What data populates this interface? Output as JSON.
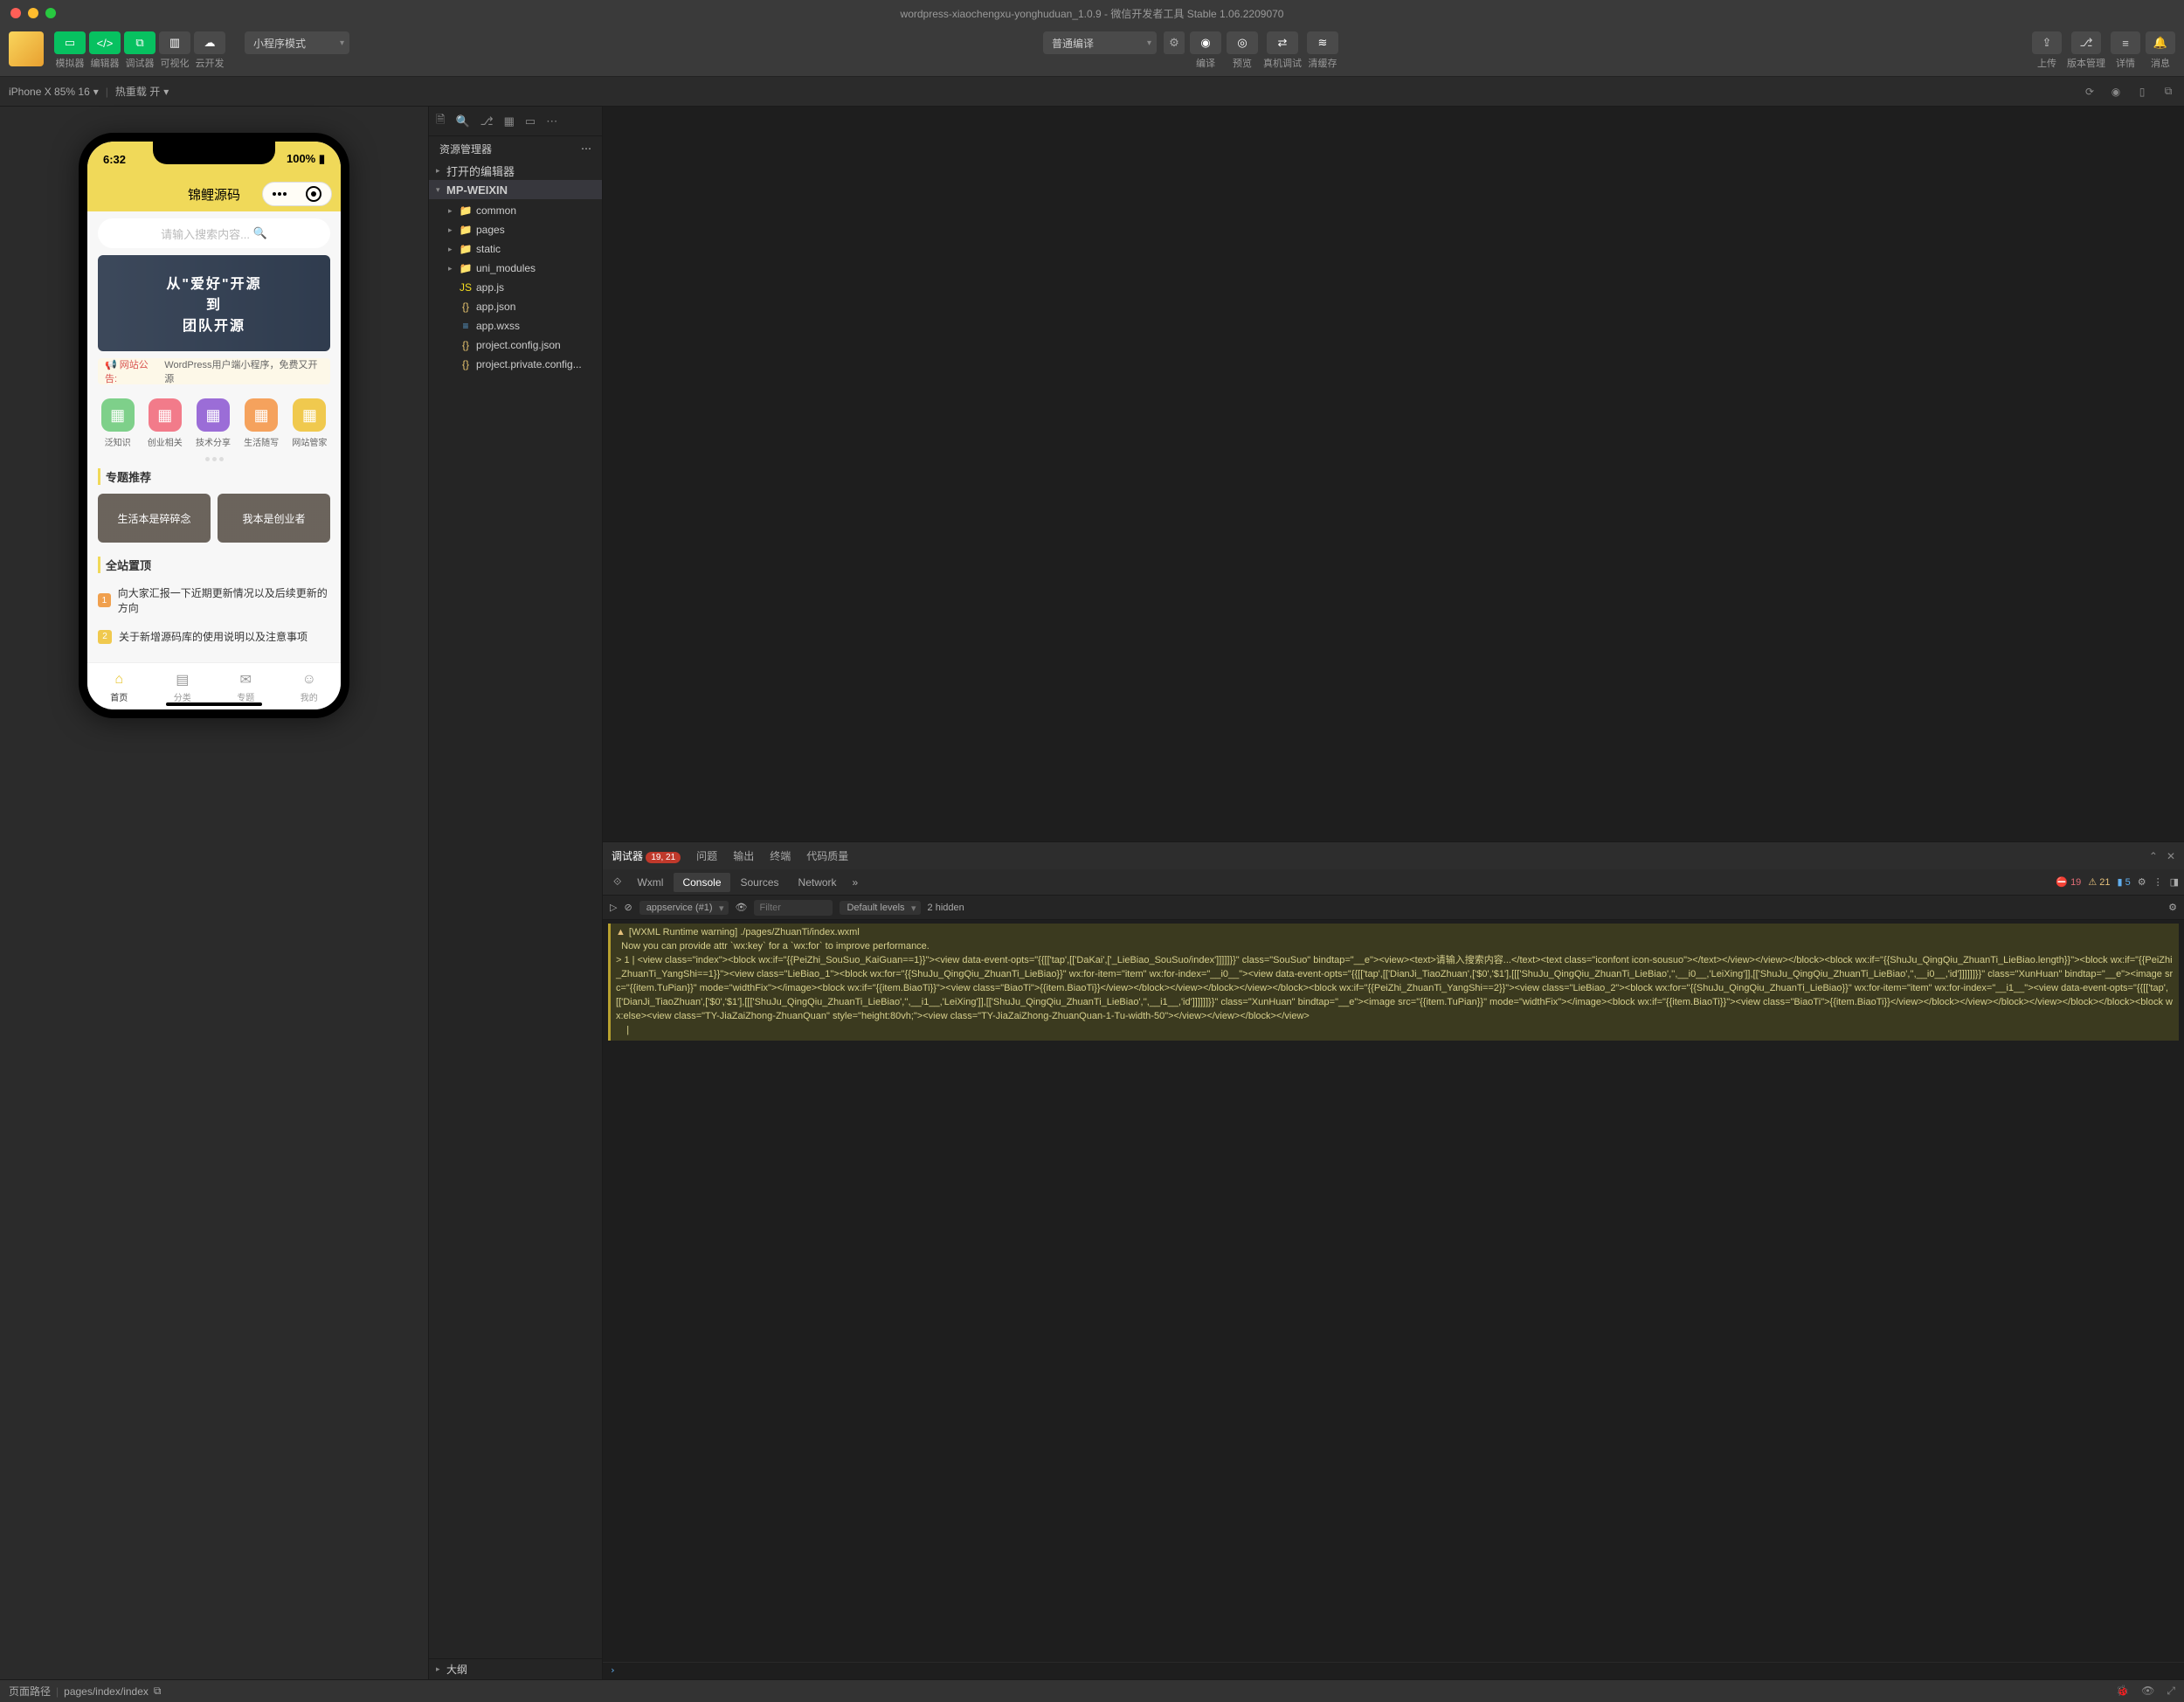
{
  "titlebar": {
    "title": "wordpress-xiaochengxu-yonghuduan_1.0.9 - 微信开发者工具 Stable 1.06.2209070"
  },
  "toolbar": {
    "buttons": {
      "simulator": "模拟器",
      "editor": "编辑器",
      "debugger": "调试器",
      "visualize": "可视化",
      "cloud": "云开发"
    },
    "mode_select": "小程序模式",
    "compile_select": "普通编译",
    "actions": {
      "compile": "编译",
      "preview": "预览",
      "real_debug": "真机调试",
      "clear_cache": "清缓存"
    },
    "right": {
      "upload": "上传",
      "version": "版本管理",
      "details": "详情",
      "notify": "消息"
    }
  },
  "simbar": {
    "device": "iPhone X 85% 16",
    "reload": "热重载 开"
  },
  "phone": {
    "time": "6:32",
    "battery": "100%",
    "app_title": "锦鲤源码",
    "search_placeholder": "请输入搜索内容...",
    "banner": {
      "line1": "从\"爱好\"开源",
      "line2": "到",
      "line3": "团队开源"
    },
    "announce_tag": "📢 网站公告:",
    "announce_text": "WordPress用户端小程序，免费又开源",
    "categories": [
      {
        "label": "泛知识",
        "color": "#7ed08a"
      },
      {
        "label": "创业相关",
        "color": "#f27b8a"
      },
      {
        "label": "技术分享",
        "color": "#9b6dd7"
      },
      {
        "label": "生活随写",
        "color": "#f5a25d"
      },
      {
        "label": "网站管家",
        "color": "#f0c94e"
      }
    ],
    "section_topic": "专题推荐",
    "topics": [
      "生活本是碎碎念",
      "我本是创业者"
    ],
    "section_top": "全站置顶",
    "top_list": [
      {
        "n": "1",
        "color": "#f0a04e",
        "text": "向大家汇报一下近期更新情况以及后续更新的方向"
      },
      {
        "n": "2",
        "color": "#f0c94e",
        "text": "关于新增源码库的使用说明以及注意事项"
      }
    ],
    "tabs": [
      {
        "label": "首页",
        "icon": "⌂"
      },
      {
        "label": "分类",
        "icon": "▤"
      },
      {
        "label": "专题",
        "icon": "✉"
      },
      {
        "label": "我的",
        "icon": "☺"
      }
    ]
  },
  "explorer": {
    "title": "资源管理器",
    "sections": {
      "open_editors": "打开的编辑器",
      "project": "MP-WEIXIN"
    },
    "tree": [
      {
        "type": "folder",
        "label": "common",
        "indent": 1
      },
      {
        "type": "folder",
        "label": "pages",
        "indent": 1
      },
      {
        "type": "folder",
        "label": "static",
        "indent": 1
      },
      {
        "type": "folder",
        "label": "uni_modules",
        "indent": 1
      },
      {
        "type": "file-js",
        "label": "app.js",
        "indent": 1
      },
      {
        "type": "file-json",
        "label": "app.json",
        "indent": 1
      },
      {
        "type": "file-wxss",
        "label": "app.wxss",
        "indent": 1
      },
      {
        "type": "file-json",
        "label": "project.config.json",
        "indent": 1
      },
      {
        "type": "file-json",
        "label": "project.private.config...",
        "indent": 1
      }
    ],
    "outline": "大纲"
  },
  "debugger": {
    "tabs": {
      "debugger": "调试器",
      "problems": "问题",
      "output": "输出",
      "terminal": "终端",
      "quality": "代码质量"
    },
    "badge": "19, 21",
    "devtools": {
      "wxml": "Wxml",
      "console": "Console",
      "sources": "Sources",
      "network": "Network"
    },
    "counts": {
      "errors": "19",
      "warnings": "21",
      "info": "5"
    },
    "context": "appservice (#1)",
    "filter_placeholder": "Filter",
    "levels": "Default levels",
    "hidden": "2 hidden",
    "warning": "[WXML Runtime warning] ./pages/ZhuanTi/index.wxml\n  Now you can provide attr `wx:key` for a `wx:for` to improve performance.\n> 1 | <view class=\"index\"><block wx:if=\"{{PeiZhi_SouSuo_KaiGuan==1}}\"><view data-event-opts=\"{{[['tap',[['DaKai',['_LieBiao_SouSuo/index']]]]]}}\" class=\"SouSuo\" bindtap=\"__e\"><view><text>请输入搜索内容...</text><text class=\"iconfont icon-sousuo\"></text></view></view></block><block wx:if=\"{{ShuJu_QingQiu_ZhuanTi_LieBiao.length}}\"><block wx:if=\"{{PeiZhi_ZhuanTi_YangShi==1}}\"><view class=\"LieBiao_1\"><block wx:for=\"{{ShuJu_QingQiu_ZhuanTi_LieBiao}}\" wx:for-item=\"item\" wx:for-index=\"__i0__\"><view data-event-opts=\"{{[['tap',[['DianJi_TiaoZhuan',['$0','$1'],[[['ShuJu_QingQiu_ZhuanTi_LieBiao','',__i0__,'LeiXing']],[['ShuJu_QingQiu_ZhuanTi_LieBiao','',__i0__,'id']]]]]]}}\" class=\"XunHuan\" bindtap=\"__e\"><image src=\"{{item.TuPian}}\" mode=\"widthFix\"></image><block wx:if=\"{{item.BiaoTi}}\"><view class=\"BiaoTi\">{{item.BiaoTi}}</view></block></view></block></view></block><block wx:if=\"{{PeiZhi_ZhuanTi_YangShi==2}}\"><view class=\"LieBiao_2\"><block wx:for=\"{{ShuJu_QingQiu_ZhuanTi_LieBiao}}\" wx:for-item=\"item\" wx:for-index=\"__i1__\"><view data-event-opts=\"{{[['tap',[['DianJi_TiaoZhuan',['$0','$1'],[[['ShuJu_QingQiu_ZhuanTi_LieBiao','',__i1__,'LeiXing']],[['ShuJu_QingQiu_ZhuanTi_LieBiao','',__i1__,'id']]]]]]}}\" class=\"XunHuan\" bindtap=\"__e\"><image src=\"{{item.TuPian}}\" mode=\"widthFix\"></image><block wx:if=\"{{item.BiaoTi}}\"><view class=\"BiaoTi\">{{item.BiaoTi}}</view></block></view></block></view></block></block><block wx:else><view class=\"TY-JiaZaiZhong-ZhuanQuan\" style=\"height:80vh;\"><view class=\"TY-JiaZaiZhong-ZhuanQuan-1-Tu-width-50\"></view></view></block></view>\n    |"
  },
  "statusbar": {
    "label": "页面路径",
    "path": "pages/index/index"
  }
}
